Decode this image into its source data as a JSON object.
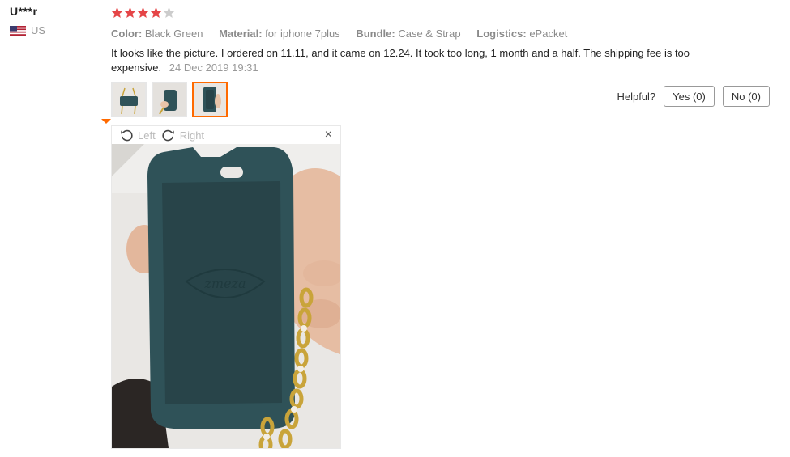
{
  "user": {
    "name": "U***r",
    "country": "US",
    "flag_icon": "us-flag-icon"
  },
  "rating": {
    "value": 4,
    "max": 5,
    "filled_color": "#e54547",
    "empty_color": "#cccccc"
  },
  "attributes": [
    {
      "key": "Color:",
      "value": "Black Green"
    },
    {
      "key": "Material:",
      "value": "for iphone 7plus"
    },
    {
      "key": "Bundle:",
      "value": "Case & Strap"
    },
    {
      "key": "Logistics:",
      "value": "ePacket"
    }
  ],
  "review": {
    "text": "It looks like the picture. I ordered on 11.11, and it came on 12.24. It took too long, 1 month and a half. The shipping fee is too expensive.",
    "date": "24 Dec 2019 19:31"
  },
  "thumbnails": [
    {
      "name": "photo-1",
      "active": false
    },
    {
      "name": "photo-2",
      "active": false
    },
    {
      "name": "photo-3",
      "active": true
    }
  ],
  "viewer": {
    "rotate_left_label": "Left",
    "rotate_right_label": "Right",
    "close_label": "×"
  },
  "helpful": {
    "label": "Helpful?",
    "yes_label": "Yes (0)",
    "no_label": "No (0)"
  },
  "colors": {
    "accent": "#ff6a00",
    "case_color": "#2f5258"
  }
}
